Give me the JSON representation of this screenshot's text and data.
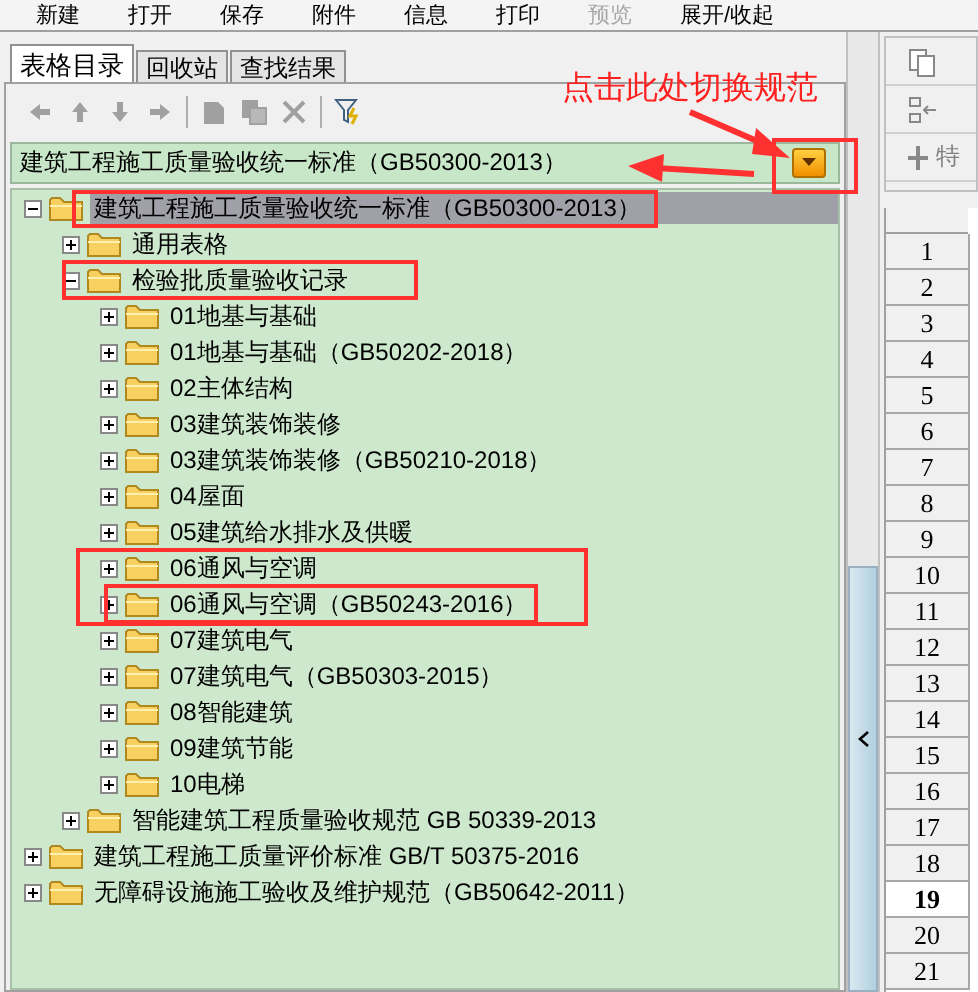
{
  "menu": [
    {
      "label": "新建",
      "disabled": false
    },
    {
      "label": "打开",
      "disabled": false
    },
    {
      "label": "保存",
      "disabled": false
    },
    {
      "label": "附件",
      "disabled": false
    },
    {
      "label": "信息",
      "disabled": false
    },
    {
      "label": "打印",
      "disabled": false
    },
    {
      "label": "预览",
      "disabled": true
    },
    {
      "label": "展开/收起",
      "disabled": false
    }
  ],
  "tabs": [
    {
      "label": "表格目录",
      "selected": true
    },
    {
      "label": "回收站",
      "selected": false
    },
    {
      "label": "查找结果",
      "selected": false
    }
  ],
  "standard_selector": {
    "value": "建筑工程施工质量验收统一标准（GB50300-2013）"
  },
  "tree": [
    {
      "label": "建筑工程施工质量验收统一标准（GB50300-2013）",
      "expanded": true,
      "selected": true,
      "children": [
        {
          "label": "通用表格",
          "expanded": false,
          "selected": false
        },
        {
          "label": "检验批质量验收记录",
          "expanded": true,
          "selected": false,
          "children": [
            {
              "label": "01地基与基础",
              "expanded": false,
              "selected": false
            },
            {
              "label": "01地基与基础（GB50202-2018）",
              "expanded": false,
              "selected": false
            },
            {
              "label": "02主体结构",
              "expanded": false,
              "selected": false
            },
            {
              "label": "03建筑装饰装修",
              "expanded": false,
              "selected": false
            },
            {
              "label": "03建筑装饰装修（GB50210-2018）",
              "expanded": false,
              "selected": false
            },
            {
              "label": "04屋面",
              "expanded": false,
              "selected": false
            },
            {
              "label": "05建筑给水排水及供暖",
              "expanded": false,
              "selected": false
            },
            {
              "label": "06通风与空调",
              "expanded": false,
              "selected": false
            },
            {
              "label": "06通风与空调（GB50243-2016）",
              "expanded": false,
              "selected": false
            },
            {
              "label": "07建筑电气",
              "expanded": false,
              "selected": false
            },
            {
              "label": "07建筑电气（GB50303-2015）",
              "expanded": false,
              "selected": false
            },
            {
              "label": "08智能建筑",
              "expanded": false,
              "selected": false
            },
            {
              "label": "09建筑节能",
              "expanded": false,
              "selected": false
            },
            {
              "label": "10电梯",
              "expanded": false,
              "selected": false
            }
          ]
        },
        {
          "label": "智能建筑工程质量验收规范 GB 50339-2013",
          "expanded": false,
          "selected": false
        }
      ]
    },
    {
      "label": "建筑工程施工质量评价标准 GB/T 50375-2016",
      "expanded": false,
      "selected": false
    },
    {
      "label": "无障碍设施施工验收及维护规范（GB50642-2011）",
      "expanded": false,
      "selected": false
    }
  ],
  "annotation": {
    "text": "点击此处切换规范"
  },
  "side_toolbar": [
    {
      "kind": "copy"
    },
    {
      "kind": "transfer"
    },
    {
      "kind": "special",
      "label": "特"
    }
  ],
  "row_headers": [
    {
      "label": "1",
      "selected": false
    },
    {
      "label": "2",
      "selected": false
    },
    {
      "label": "3",
      "selected": false
    },
    {
      "label": "4",
      "selected": false
    },
    {
      "label": "5",
      "selected": false
    },
    {
      "label": "6",
      "selected": false
    },
    {
      "label": "7",
      "selected": false
    },
    {
      "label": "8",
      "selected": false
    },
    {
      "label": "9",
      "selected": false
    },
    {
      "label": "10",
      "selected": false
    },
    {
      "label": "11",
      "selected": false
    },
    {
      "label": "12",
      "selected": false
    },
    {
      "label": "13",
      "selected": false
    },
    {
      "label": "14",
      "selected": false
    },
    {
      "label": "15",
      "selected": false
    },
    {
      "label": "16",
      "selected": false
    },
    {
      "label": "17",
      "selected": false
    },
    {
      "label": "18",
      "selected": false
    },
    {
      "label": "19",
      "selected": true
    },
    {
      "label": "20",
      "selected": false
    },
    {
      "label": "21",
      "selected": false
    }
  ]
}
